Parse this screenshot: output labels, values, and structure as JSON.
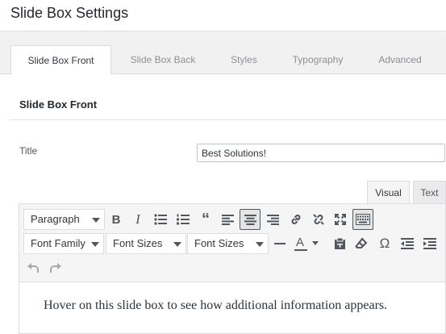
{
  "header": {
    "title": "Slide Box Settings"
  },
  "tabs": [
    {
      "label": "Slide Box Front",
      "active": true
    },
    {
      "label": "Slide Box Back",
      "active": false
    },
    {
      "label": "Styles",
      "active": false
    },
    {
      "label": "Typography",
      "active": false
    },
    {
      "label": "Advanced",
      "active": false
    }
  ],
  "section": {
    "title": "Slide Box Front"
  },
  "form": {
    "title_label": "Title",
    "title_value": "Best Solutions!"
  },
  "editor": {
    "modes": [
      {
        "label": "Visual",
        "active": true
      },
      {
        "label": "Text",
        "active": false
      }
    ],
    "format_select": "Paragraph",
    "font_family_select": "Font Family",
    "font_size_select_1": "Font Sizes",
    "font_size_select_2": "Font Sizes",
    "text_color_letter": "A",
    "body_text": "Hover on this slide box to see how additional information appears."
  },
  "icons": [
    "bold-icon",
    "italic-icon",
    "bullet-list-icon",
    "numbered-list-icon",
    "blockquote-icon",
    "align-left-icon",
    "align-center-icon",
    "align-right-icon",
    "link-icon",
    "unlink-icon",
    "fullscreen-icon",
    "toolbar-toggle-icon",
    "horizontal-line-icon",
    "text-color-icon",
    "paste-text-icon",
    "clear-formatting-icon",
    "omega-icon",
    "outdent-icon",
    "indent-icon",
    "undo-icon",
    "redo-icon"
  ],
  "colors": {
    "accent": "#50575e",
    "tab_bg": "#f1f1f1",
    "toolbar_bg": "#f5f5f5"
  }
}
